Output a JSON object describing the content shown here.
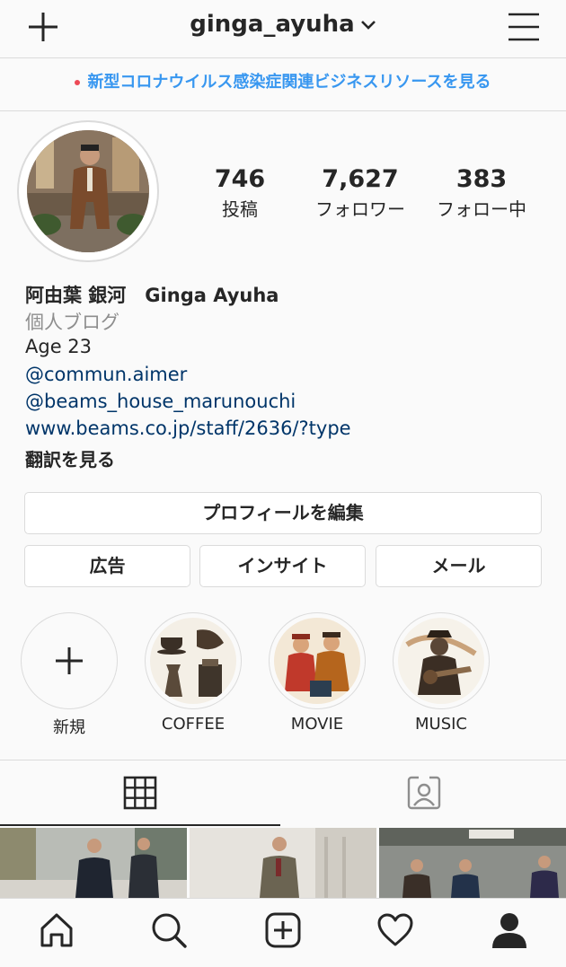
{
  "header": {
    "username": "ginga_ayuha",
    "new_post_icon": "plus-icon",
    "switch_account_icon": "chevron-down-icon",
    "menu_icon": "hamburger-menu-icon"
  },
  "banner": {
    "text": "新型コロナウイルス感染症関連ビジネスリソースを見る"
  },
  "stats": [
    {
      "value": "746",
      "label": "投稿"
    },
    {
      "value": "7,627",
      "label": "フォロワー"
    },
    {
      "value": "383",
      "label": "フォロー中"
    }
  ],
  "bio": {
    "name": "阿由葉 銀河　Ginga Ayuha",
    "category": "個人ブログ",
    "text": "Age 23",
    "links": [
      "@commun.aimer",
      "@beams_house_marunouchi",
      "www.beams.co.jp/staff/2636/?type"
    ],
    "translate": "翻訳を見る"
  },
  "buttons": {
    "edit_profile": "プロフィールを編集",
    "ads": "広告",
    "insights": "インサイト",
    "email": "メール"
  },
  "highlights": [
    {
      "label": "新規"
    },
    {
      "label": "COFFEE"
    },
    {
      "label": "MOVIE"
    },
    {
      "label": "MUSIC"
    }
  ],
  "tabs": [
    {
      "icon": "grid-icon",
      "active": true
    },
    {
      "icon": "tagged-person-icon",
      "active": false
    }
  ],
  "bottom_nav": [
    "home-icon",
    "search-icon",
    "new-post-icon",
    "activity-heart-icon",
    "profile-icon"
  ],
  "colors": {
    "link_blue": "#3897f0",
    "bio_link": "#003569",
    "border": "#dbdbdb",
    "text": "#262626",
    "muted": "#8e8e8e",
    "banner_dot": "#ed4956"
  }
}
